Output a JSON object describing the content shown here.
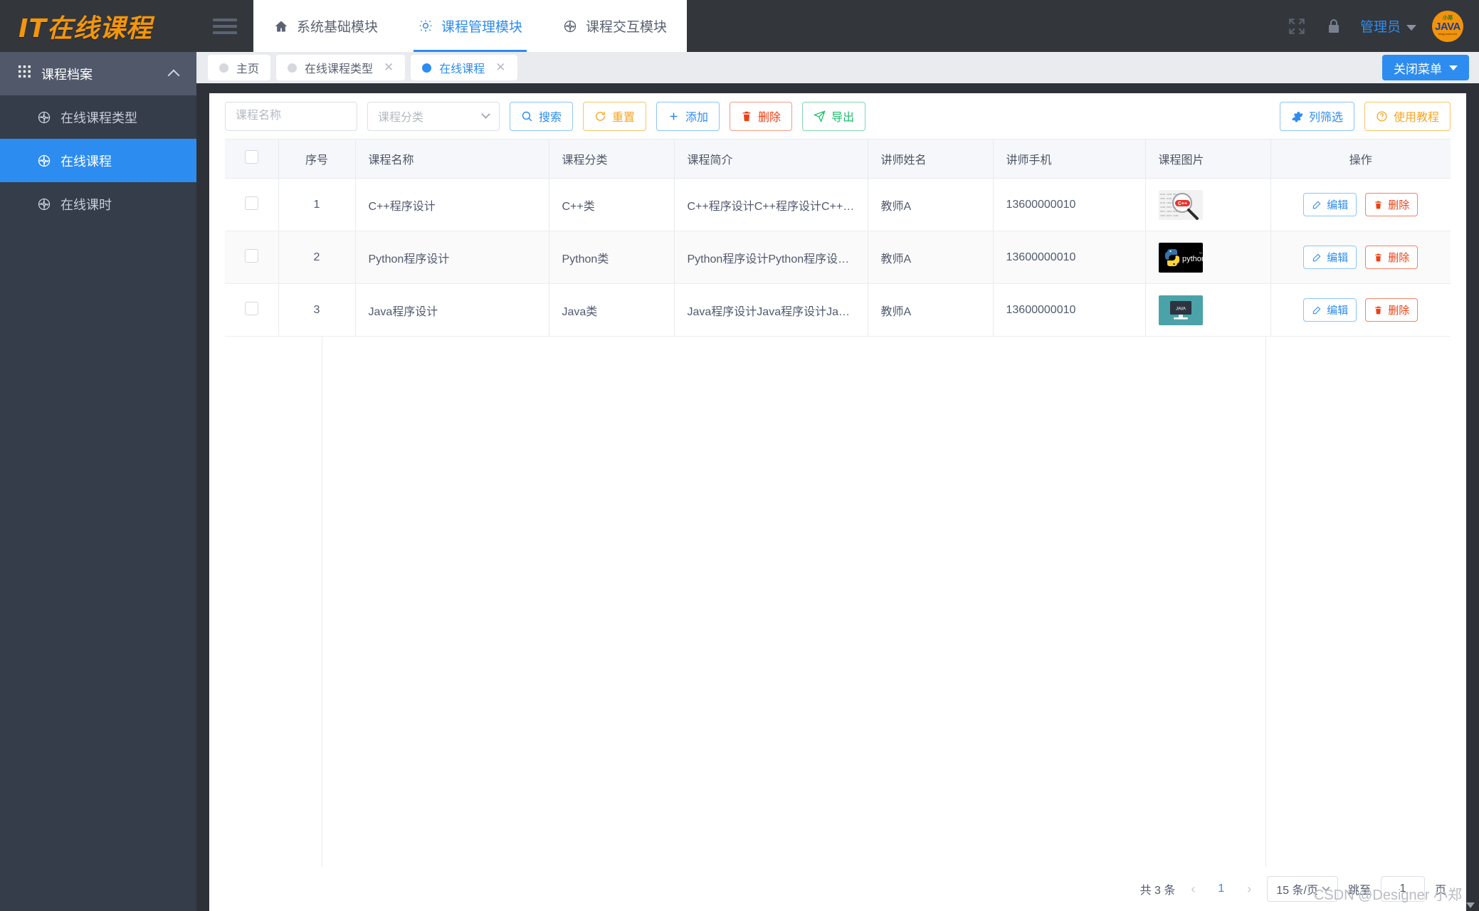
{
  "header": {
    "logo": "IT在线课程",
    "menu_toggle_icon": "hamburger-icon",
    "nav": [
      {
        "label": "系统基础模块",
        "icon": "home-icon",
        "active": false
      },
      {
        "label": "课程管理模块",
        "icon": "bulb-icon",
        "active": true
      },
      {
        "label": "课程交互模块",
        "icon": "aperture-icon",
        "active": false
      }
    ],
    "fullscreen_icon": "fullscreen-icon",
    "lock_icon": "lock-icon",
    "user_name": "管理员",
    "avatar": {
      "top": "小郑",
      "mid": "JAVA",
      "bot": "blog.csdn.net"
    }
  },
  "sidebar": {
    "group": {
      "label": "课程档案",
      "icon": "grid-icon",
      "collapse_icon": "chevron-up-icon"
    },
    "items": [
      {
        "label": "在线课程类型",
        "icon": "aperture-icon",
        "active": false
      },
      {
        "label": "在线课程",
        "icon": "aperture-icon",
        "active": true
      },
      {
        "label": "在线课时",
        "icon": "aperture-icon",
        "active": false
      }
    ]
  },
  "tabs": {
    "items": [
      {
        "label": "主页",
        "active": false,
        "closable": false
      },
      {
        "label": "在线课程类型",
        "active": false,
        "closable": true
      },
      {
        "label": "在线课程",
        "active": true,
        "closable": true
      }
    ],
    "close_menu_label": "关闭菜单"
  },
  "toolbar": {
    "name_input_value": "",
    "name_input_placeholder": "课程名称",
    "category_select_value": "课程分类",
    "search_label": "搜索",
    "reset_label": "重置",
    "add_label": "添加",
    "delete_label": "删除",
    "export_label": "导出",
    "column_filter_label": "列筛选",
    "tutorial_label": "使用教程"
  },
  "table": {
    "columns": [
      "序号",
      "课程名称",
      "课程分类",
      "课程简介",
      "讲师姓名",
      "讲师手机",
      "课程图片",
      "操作"
    ],
    "rows": [
      {
        "index": "1",
        "name": "C++程序设计",
        "category": "C++类",
        "intro": "C++程序设计C++程序设计C++…",
        "teacher": "教师A",
        "phone": "13600000010",
        "image": "cpp-course-thumbnail"
      },
      {
        "index": "2",
        "name": "Python程序设计",
        "category": "Python类",
        "intro": "Python程序设计Python程序设计…",
        "teacher": "教师A",
        "phone": "13600000010",
        "image": "python-course-thumbnail"
      },
      {
        "index": "3",
        "name": "Java程序设计",
        "category": "Java类",
        "intro": "Java程序设计Java程序设计Jav…",
        "teacher": "教师A",
        "phone": "13600000010",
        "image": "java-course-thumbnail"
      }
    ],
    "edit_label": "编辑",
    "delete_label": "删除"
  },
  "pagination": {
    "total": "共 3 条",
    "prev_icon": "chevron-left-icon",
    "current_page": "1",
    "next_icon": "chevron-right-icon",
    "page_size": "15 条/页",
    "jump_label": "跳至",
    "jump_value": "1",
    "page_unit": "页"
  },
  "watermark": "CSDN @Designer 小郑",
  "colors": {
    "brand_orange": "#f2960b",
    "accent_blue": "#2d8cf0",
    "sidebar_bg": "#353c4a",
    "sidebar_group_bg": "#50586a",
    "header_bg": "#33363b",
    "danger_red": "#ed4014",
    "success_green": "#19be6b",
    "warning_orange": "#f5a623"
  }
}
